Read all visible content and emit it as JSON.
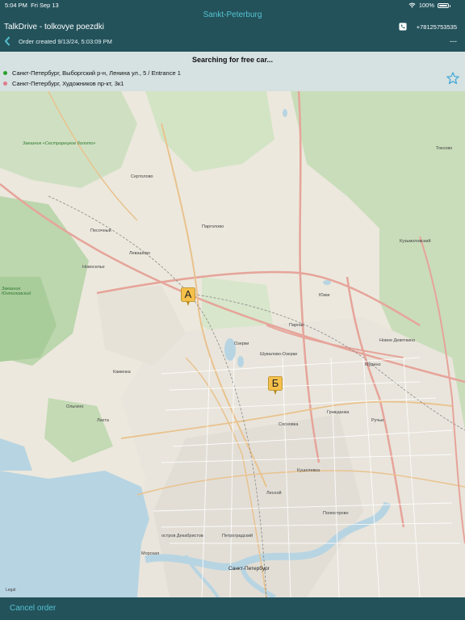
{
  "status_bar": {
    "time": "5:04 PM",
    "date": "Fri Sep 13",
    "battery": "100%",
    "battery_level": 1.0
  },
  "header": {
    "city": "Sankt-Peterburg",
    "app_title": "TalkDrive - tolkovye poezdki",
    "phone": "+78125753535",
    "order_created": "Order created 9/13/24, 5:03:09 PM",
    "extra": "---"
  },
  "order_panel": {
    "status": "Searching for free car...",
    "from_address": "Санкт-Петербург, Выборгский р-н, Ленина ул., 5 / Entrance 1",
    "to_address": "Санкт-Петербург, Художников пр-кт, 3к1",
    "from_color": "#2aa02a",
    "to_color": "#e07a8a"
  },
  "map": {
    "marker_a": "А",
    "marker_b": "Б",
    "legal": "Legal",
    "labels": {
      "sertolovo": "Сертолово",
      "pesochny": "Песочный",
      "levashovo": "Левашово",
      "novosely": "Новоселье",
      "pargolovo": "Парголово",
      "ozerki": "Озерки",
      "kuzmolovsky": "Кузьмоловский",
      "murino": "Мурино",
      "novoe_devyatkino": "Новое Девяткино",
      "toksovo": "Токсово",
      "parnas": "Парнас",
      "shuvalovo": "Шувалово-Озерки",
      "lakhta": "Лахта",
      "olgino": "Ольгино",
      "kamenka": "Каменка",
      "yukki": "Юкки",
      "sosnovka": "Сосновка",
      "grazhdanka": "Гражданка",
      "rucheyi": "Ручьи",
      "kushelevka": "Кушелевка",
      "polyustrovo": "Полюстрово",
      "lesnoy": "Лесной",
      "petrogradsky": "Петроградский",
      "spb": "Санкт-Петербург",
      "vasilievsky": "остров Декабристов",
      "ryibatskoe": "Морская",
      "nature": "Заказник Юнтоловский",
      "nature2": "Заказник «Сестрорецкое болото»"
    }
  },
  "footer": {
    "cancel_label": "Cancel order"
  }
}
